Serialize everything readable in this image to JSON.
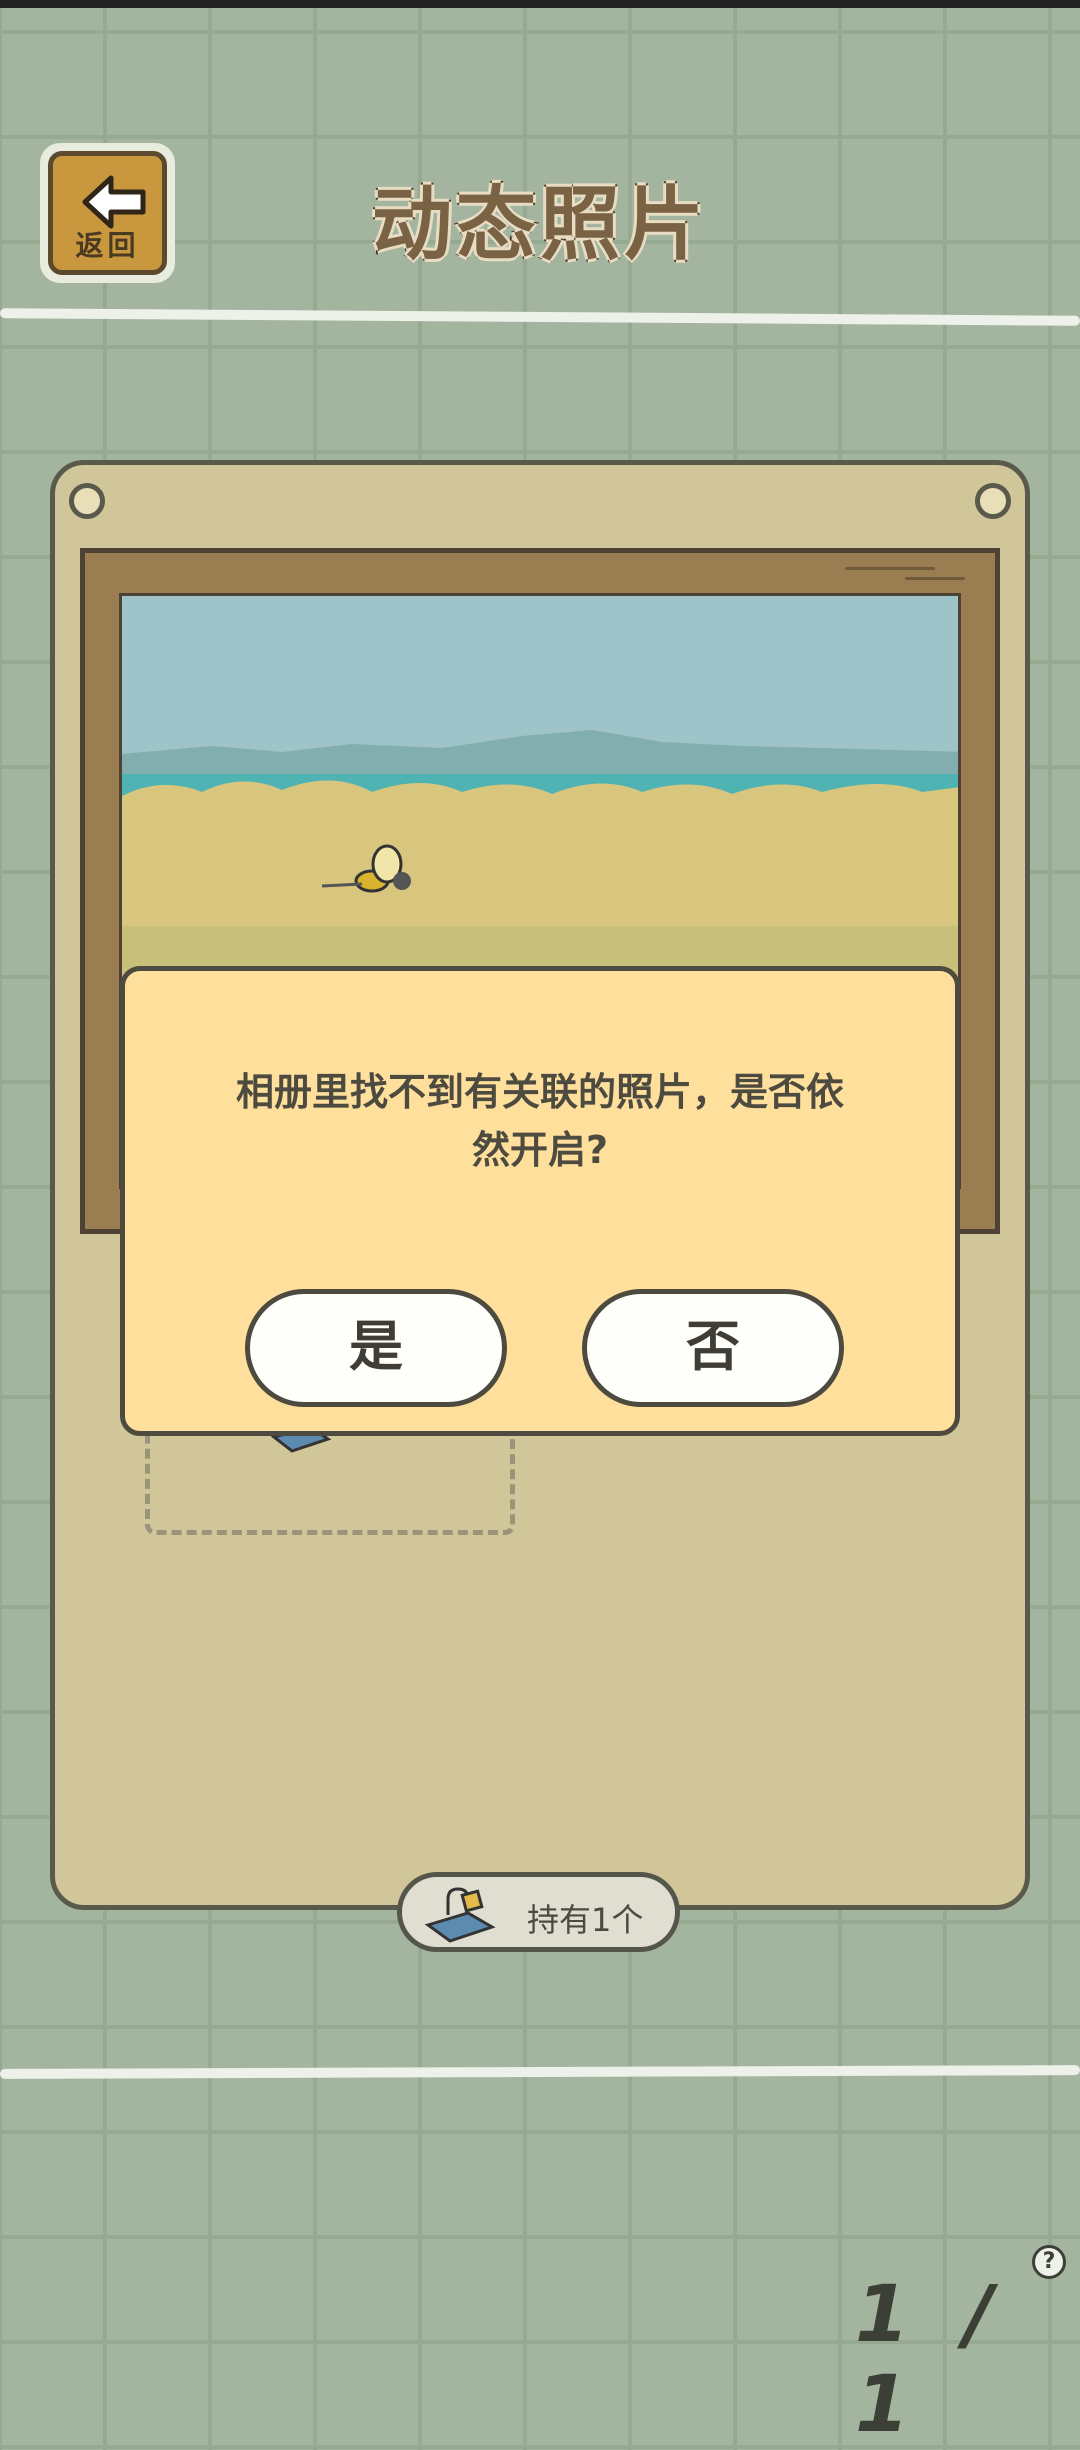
{
  "header": {
    "back_label": "返回",
    "title": "动态照片"
  },
  "inventory": {
    "count_label": "持有1个"
  },
  "dialog": {
    "message_line1": "相册里找不到有关联的照片，是否依",
    "message_line2": "然开启?",
    "yes_label": "是",
    "no_label": "否"
  },
  "footer": {
    "pager_text": "1 / 1",
    "help_symbol": "?"
  },
  "icons": {
    "back": "back-arrow-icon",
    "ticket": "ticket-icon",
    "help": "help-icon"
  },
  "colors": {
    "background": "#a3b59f",
    "panel": "#d1c699",
    "dialog": "#ffdf9c",
    "frame_wood": "#9b7d52"
  }
}
